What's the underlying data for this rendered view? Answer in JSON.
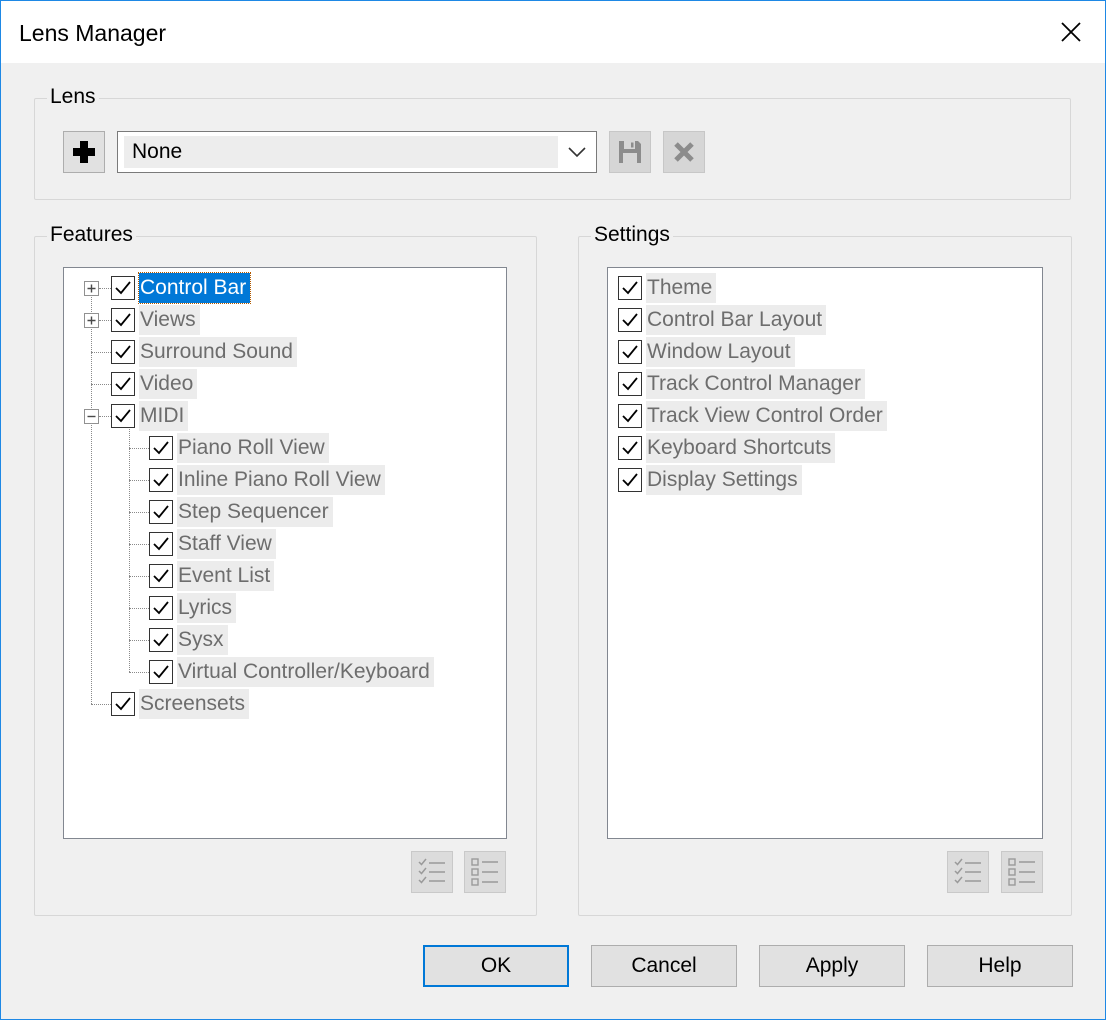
{
  "window": {
    "title": "Lens Manager"
  },
  "lens": {
    "group_label": "Lens",
    "selected": "None"
  },
  "features": {
    "group_label": "Features",
    "items": [
      {
        "label": "Control Bar",
        "checked": true,
        "selected": true,
        "expandable": "collapsed"
      },
      {
        "label": "Views",
        "checked": true,
        "expandable": "collapsed"
      },
      {
        "label": "Surround Sound",
        "checked": true
      },
      {
        "label": "Video",
        "checked": true
      },
      {
        "label": "MIDI",
        "checked": true,
        "expandable": "expanded"
      },
      {
        "label": "Piano Roll View",
        "checked": true
      },
      {
        "label": "Inline Piano Roll View",
        "checked": true
      },
      {
        "label": "Step Sequencer",
        "checked": true
      },
      {
        "label": "Staff View",
        "checked": true
      },
      {
        "label": "Event List",
        "checked": true
      },
      {
        "label": "Lyrics",
        "checked": true
      },
      {
        "label": "Sysx",
        "checked": true
      },
      {
        "label": "Virtual Controller/Keyboard",
        "checked": true
      },
      {
        "label": "Screensets",
        "checked": true
      }
    ]
  },
  "settings": {
    "group_label": "Settings",
    "items": [
      {
        "label": "Theme",
        "checked": true
      },
      {
        "label": "Control Bar Layout",
        "checked": true
      },
      {
        "label": "Window Layout",
        "checked": true
      },
      {
        "label": "Track Control Manager",
        "checked": true
      },
      {
        "label": "Track View Control Order",
        "checked": true
      },
      {
        "label": "Keyboard Shortcuts",
        "checked": true
      },
      {
        "label": "Display Settings",
        "checked": true
      }
    ]
  },
  "buttons": {
    "ok": "OK",
    "cancel": "Cancel",
    "apply": "Apply",
    "help": "Help"
  },
  "colors": {
    "selection": "#0078d7",
    "window_border": "#1e88e5"
  }
}
